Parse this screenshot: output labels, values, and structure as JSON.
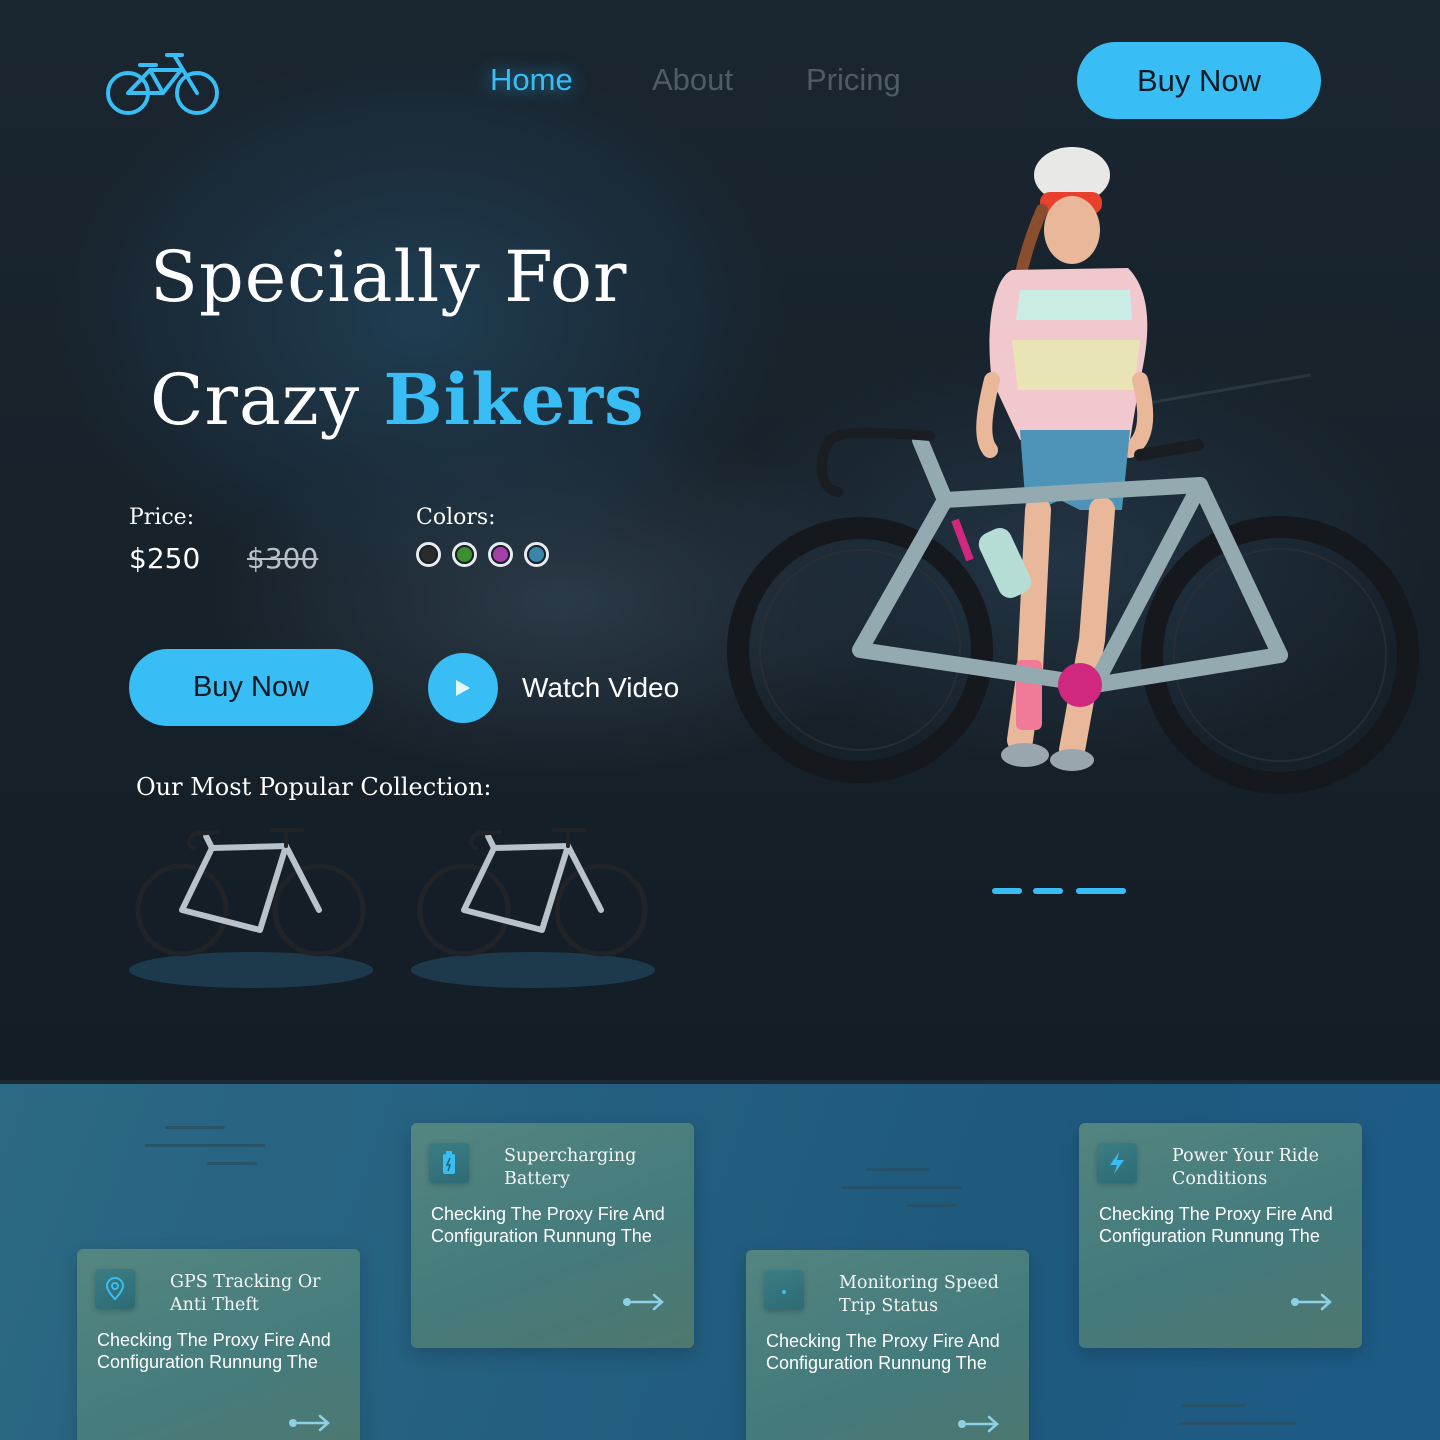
{
  "nav": {
    "logo": "bicycle-logo",
    "links": [
      "Home",
      "About",
      "Pricing"
    ],
    "buy_label": "Buy Now"
  },
  "hero": {
    "line1": "Specially For",
    "line2_plain": "Crazy ",
    "line2_accent": "Bikers",
    "price_label": "Price:",
    "price_current": "$250",
    "price_old": "$300",
    "colors_label": "Colors:",
    "colors": [
      "#2b2b2b",
      "#3a8f2e",
      "#a23fa8",
      "#3a86a8"
    ],
    "buy_label": "Buy Now",
    "watch_label": "Watch Video",
    "collection_label": "Our Most Popular Collection:",
    "slides_total": 3,
    "slides_active": 3
  },
  "theme": {
    "accent": "#38bdf4",
    "background": "#17212b"
  },
  "features": [
    {
      "icon": "location-pin-icon",
      "title": "GPS Tracking Or Anti Theft",
      "text": "Checking The Proxy Fire And Configuration Runnung The"
    },
    {
      "icon": "battery-icon",
      "title": "Supercharging Battery",
      "text": "Checking The Proxy Fire And Configuration Runnung The"
    },
    {
      "icon": "speed-icon",
      "title": "Monitoring Speed Trip Status",
      "text": "Checking The Proxy Fire And Configuration Runnung The"
    },
    {
      "icon": "lightning-icon",
      "title": "Power Your Ride Conditions",
      "text": "Checking The Proxy Fire And Configuration Runnung The"
    }
  ]
}
